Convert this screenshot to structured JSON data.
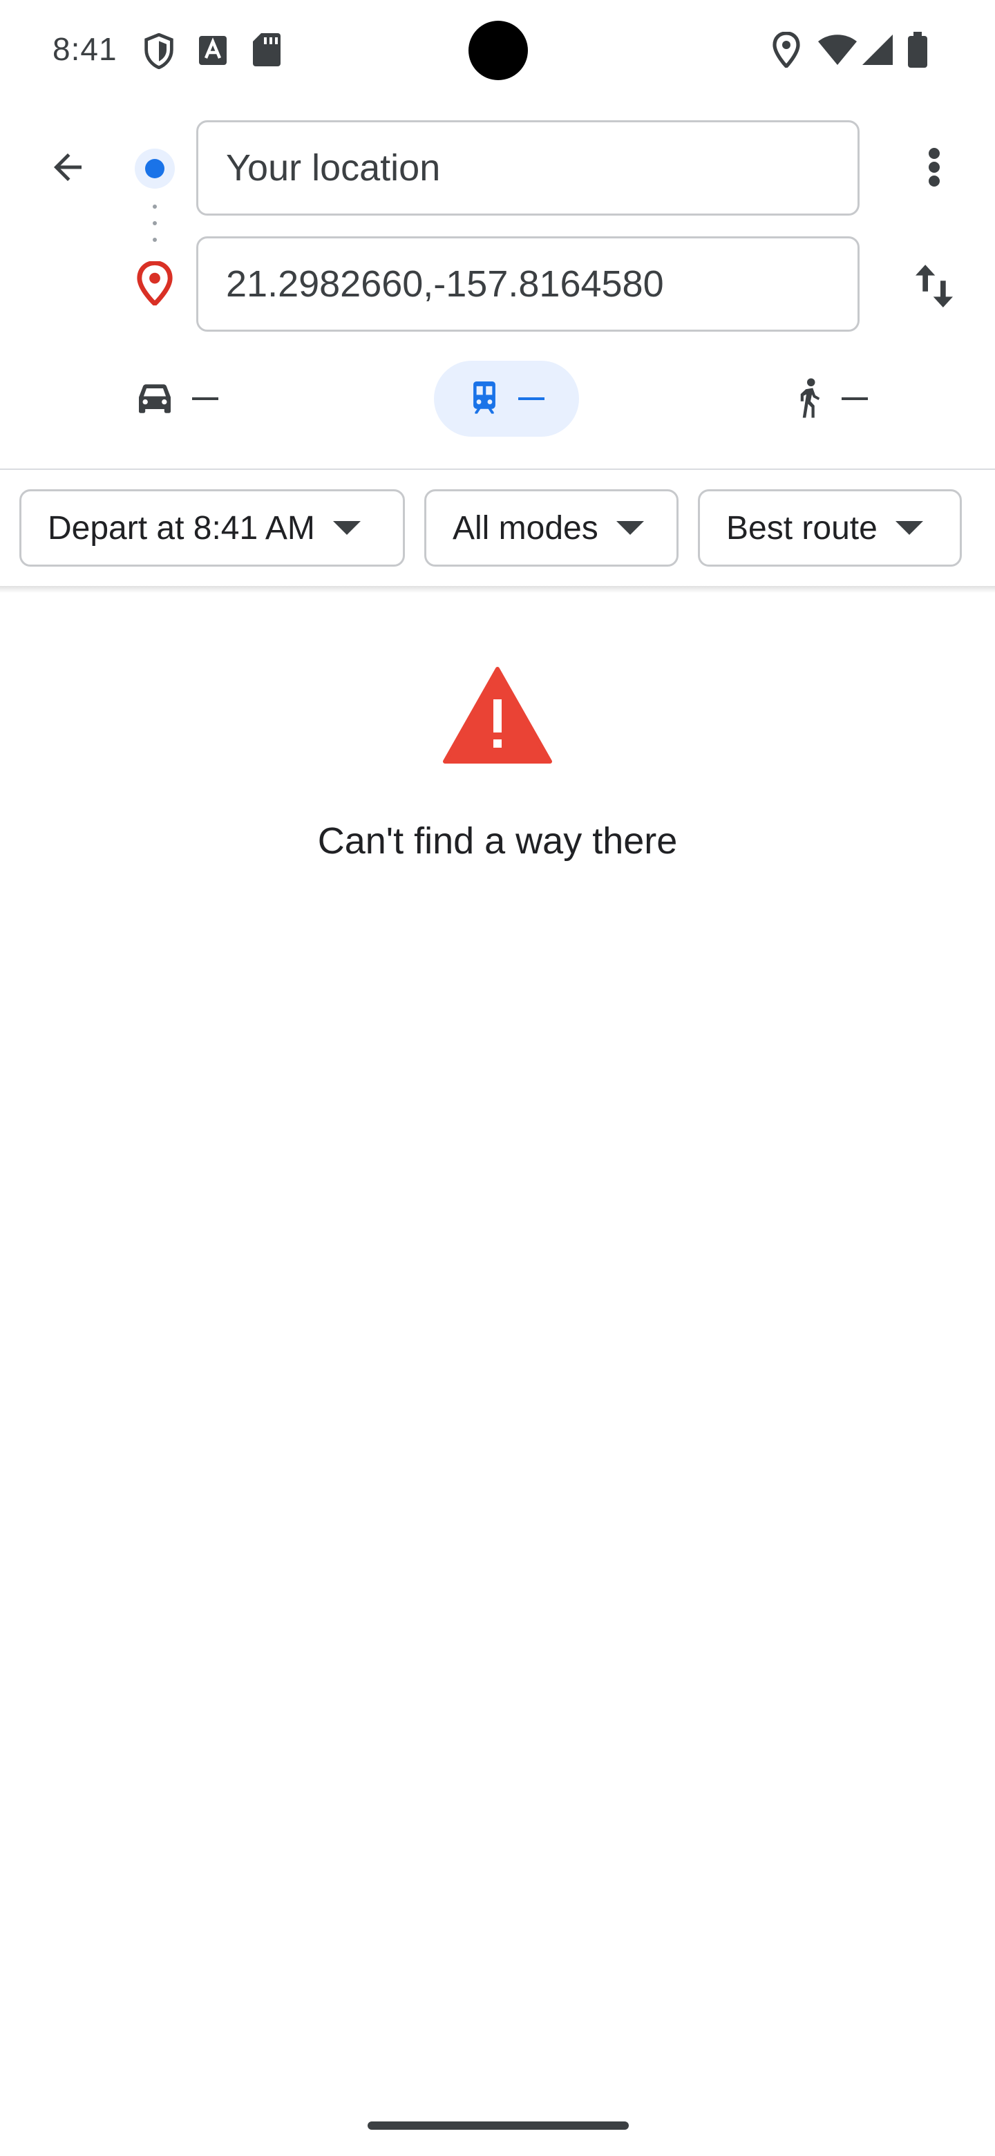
{
  "status_bar": {
    "time": "8:41",
    "left_icons": [
      "shield-icon",
      "text-a-icon",
      "sd-card-icon"
    ],
    "right_icons": [
      "location-icon",
      "wifi-icon",
      "cellular-signal-icon",
      "battery-icon"
    ]
  },
  "directions": {
    "origin": {
      "value": "Your location",
      "icon": "origin-dot-icon"
    },
    "destination": {
      "value": "21.2982660,-157.8164580",
      "icon": "destination-pin-icon"
    }
  },
  "travel_modes": [
    {
      "name": "drive",
      "icon": "car-icon",
      "duration": "—",
      "selected": false
    },
    {
      "name": "transit",
      "icon": "train-icon",
      "duration": "—",
      "selected": true
    },
    {
      "name": "walk",
      "icon": "walk-icon",
      "duration": "—",
      "selected": false
    }
  ],
  "filters": {
    "depart": "Depart at 8:41 AM",
    "modes": "All modes",
    "route_preference": "Best route"
  },
  "empty_state": {
    "icon": "warning-icon",
    "message": "Can't find a way there"
  },
  "colors": {
    "accent_blue": "#1a73e8",
    "accent_blue_light": "#e8f0fe",
    "warning_red": "#ea4335",
    "pin_red": "#d93025",
    "text_primary": "#202124",
    "text_secondary": "#3c4043",
    "border": "#c7c9cc"
  }
}
